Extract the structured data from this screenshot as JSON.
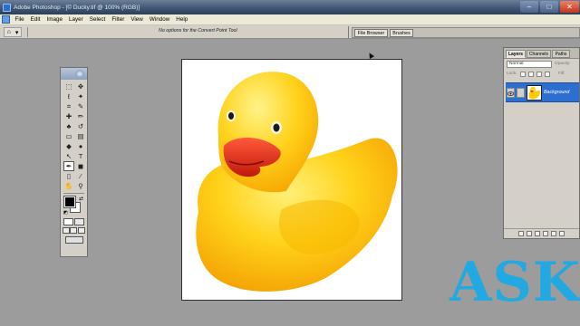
{
  "window": {
    "title": "Adobe Photoshop - [© Ducky.tif @ 100% (RGB)]",
    "controls": {
      "minimize": "–",
      "maximize": "□",
      "close": "✕"
    }
  },
  "menu": [
    "File",
    "Edit",
    "Image",
    "Layer",
    "Select",
    "Filter",
    "View",
    "Window",
    "Help"
  ],
  "options_bar": {
    "hint": "No options for the Convert Point Tool",
    "preset_glyph": "⌂",
    "preset_arrow": "▾"
  },
  "palette_well": {
    "tabs": [
      "File Browser",
      "Brushes"
    ]
  },
  "toolbox": {
    "tools": [
      {
        "name": "marquee-tool",
        "glyph": "⬚"
      },
      {
        "name": "move-tool",
        "glyph": "✥"
      },
      {
        "name": "lasso-tool",
        "glyph": "ℓ"
      },
      {
        "name": "magic-wand-tool",
        "glyph": "✦"
      },
      {
        "name": "crop-tool",
        "glyph": "⌗"
      },
      {
        "name": "slice-tool",
        "glyph": "✎"
      },
      {
        "name": "healing-brush-tool",
        "glyph": "✚"
      },
      {
        "name": "brush-tool",
        "glyph": "✏"
      },
      {
        "name": "clone-stamp-tool",
        "glyph": "♣"
      },
      {
        "name": "history-brush-tool",
        "glyph": "↺"
      },
      {
        "name": "eraser-tool",
        "glyph": "▭"
      },
      {
        "name": "gradient-tool",
        "glyph": "▤"
      },
      {
        "name": "blur-tool",
        "glyph": "◆"
      },
      {
        "name": "dodge-tool",
        "glyph": "●"
      },
      {
        "name": "path-selection-tool",
        "glyph": "↖"
      },
      {
        "name": "type-tool",
        "glyph": "T"
      },
      {
        "name": "pen-tool",
        "glyph": "✒",
        "active": true
      },
      {
        "name": "shape-tool",
        "glyph": "◼"
      },
      {
        "name": "notes-tool",
        "glyph": "▯"
      },
      {
        "name": "eyedropper-tool",
        "glyph": "⁄"
      },
      {
        "name": "hand-tool",
        "glyph": "✋"
      },
      {
        "name": "zoom-tool",
        "glyph": "⚲"
      }
    ],
    "swap_glyph": "⇄",
    "default_glyph": "◩"
  },
  "layers_palette": {
    "tabs": [
      "Layers",
      "Channels",
      "Paths"
    ],
    "blend_mode": "Normal",
    "opacity_label": "Opacity:",
    "lock_label": "Lock:",
    "fill_label": "Fill:",
    "layer_name": "Background",
    "eye_glyph": "👁"
  },
  "watermark": "ASK",
  "colors": {
    "duck_yellow": "#ffc107",
    "beak_red": "#e0281a",
    "watermark_blue": "#23a9e1",
    "layer_selected": "#2c6fd1"
  }
}
